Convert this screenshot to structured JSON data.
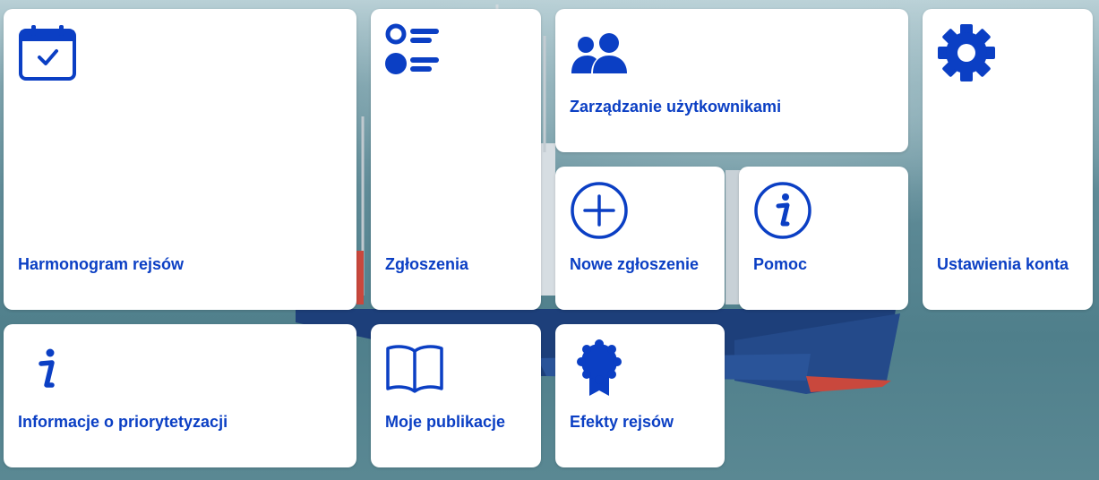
{
  "tiles": {
    "harmonogram": {
      "label": "Harmonogram rejsów",
      "icon": "calendar-check-icon"
    },
    "zgloszenia": {
      "label": "Zgłoszenia",
      "icon": "list-icon"
    },
    "zarzadzanie": {
      "label": "Zarządzanie użytkownikami",
      "icon": "users-icon"
    },
    "ustawienia": {
      "label": "Ustawienia konta",
      "icon": "gear-icon"
    },
    "nowe": {
      "label": "Nowe zgłoszenie",
      "icon": "plus-circle-icon"
    },
    "pomoc": {
      "label": "Pomoc",
      "icon": "info-circle-icon"
    },
    "informacje": {
      "label": "Informacje o priorytetyzacji",
      "icon": "info-icon"
    },
    "publikacje": {
      "label": "Moje publikacje",
      "icon": "book-icon"
    },
    "efekty": {
      "label": "Efekty rejsów",
      "icon": "award-icon"
    }
  },
  "colors": {
    "accent": "#0b3fc4",
    "tile_bg": "#ffffff"
  }
}
